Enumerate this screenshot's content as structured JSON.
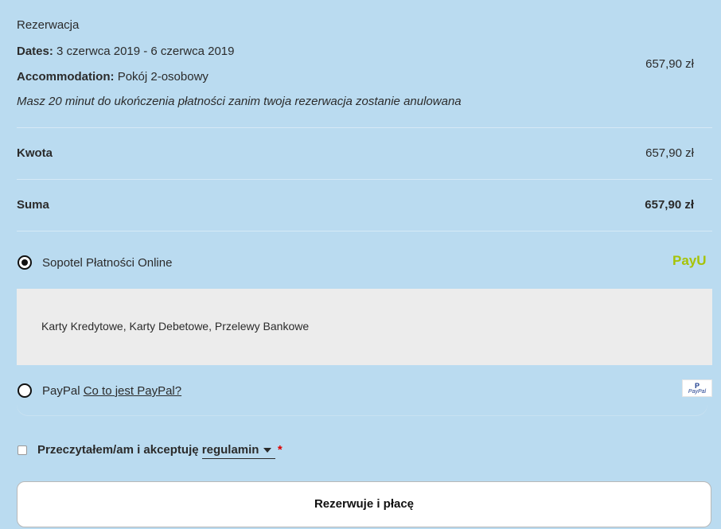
{
  "reservation": {
    "heading": "Rezerwacja",
    "dates_label": "Dates:",
    "dates_value": "3 czerwca 2019 - 6 czerwca 2019",
    "accommodation_label": "Accommodation:",
    "accommodation_value": "Pokój 2-osobowy",
    "timer_note": "Masz 20 minut do ukończenia płatności zanim twoja rezerwacja zostanie anulowana",
    "price": "657,90 zł"
  },
  "totals": {
    "amount_label": "Kwota",
    "amount_value": "657,90 zł",
    "sum_label": "Suma",
    "sum_value": "657,90 zł"
  },
  "payment": {
    "payu_label": "Sopotel Płatności Online",
    "payu_logo": "PayU",
    "payu_description": "Karty Kredytowe, Karty Debetowe, Przelewy Bankowe",
    "paypal_label": "PayPal",
    "paypal_link": "Co to jest PayPal?",
    "paypal_logo": "PayPal",
    "selected": "payu"
  },
  "terms": {
    "text": "Przeczytałem/am i akceptuję",
    "link": "regulamin",
    "required_mark": "*"
  },
  "submit_label": "Rezerwuje i płacę"
}
